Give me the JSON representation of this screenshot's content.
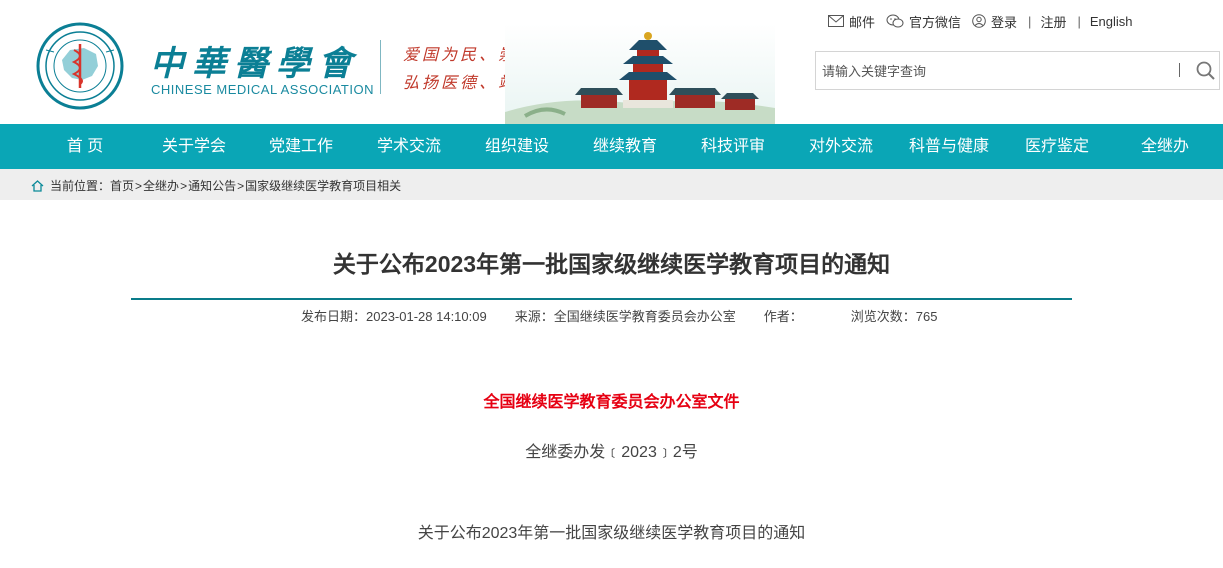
{
  "header": {
    "logo_cn": "中華醫學會",
    "logo_en": "CHINESE MEDICAL ASSOCIATION",
    "emblem_text_top": "中华医学会",
    "emblem_text_en": "CHINESE MEDICAL ASSOCIATION",
    "emblem_year": "1915",
    "slogan_line1": "爱国为民、崇尚学术",
    "slogan_line2": "弘扬医德、竭诚服务",
    "brand_color": "#0aa6b6"
  },
  "toplinks": {
    "mail": "邮件",
    "wechat": "官方微信",
    "login": "登录",
    "sep": "|",
    "register": "注册",
    "english": "English"
  },
  "search": {
    "placeholder": "请输入关键字查询",
    "icon": "search-icon"
  },
  "nav": {
    "items": [
      {
        "label": "首 页"
      },
      {
        "label": "关于学会"
      },
      {
        "label": "党建工作"
      },
      {
        "label": "学术交流"
      },
      {
        "label": "组织建设"
      },
      {
        "label": "继续教育"
      },
      {
        "label": "科技评审"
      },
      {
        "label": "对外交流"
      },
      {
        "label": "科普与健康"
      },
      {
        "label": "医疗鉴定"
      },
      {
        "label": "全继办"
      }
    ]
  },
  "breadcrumb": {
    "prefix": "当前位置：",
    "items": [
      "首页",
      "全继办",
      "通知公告",
      "国家级继续医学教育项目相关"
    ],
    "sep": ">"
  },
  "article": {
    "title": "关于公布2023年第一批国家级继续医学教育项目的通知",
    "publish_date": "发布日期：2023-01-28 14:10:09",
    "source": "来源：全国继续医学教育委员会办公室",
    "author": "作者：",
    "views": "浏览次数：765",
    "doc_org": "全国继续医学教育委员会办公室文件",
    "doc_number": "全继委办发﹝2023﹞2号",
    "doc_subject": "关于公布2023年第一批国家级继续医学教育项目的通知",
    "accent_red": "#e60012",
    "rule_color": "#0a7c8a"
  }
}
